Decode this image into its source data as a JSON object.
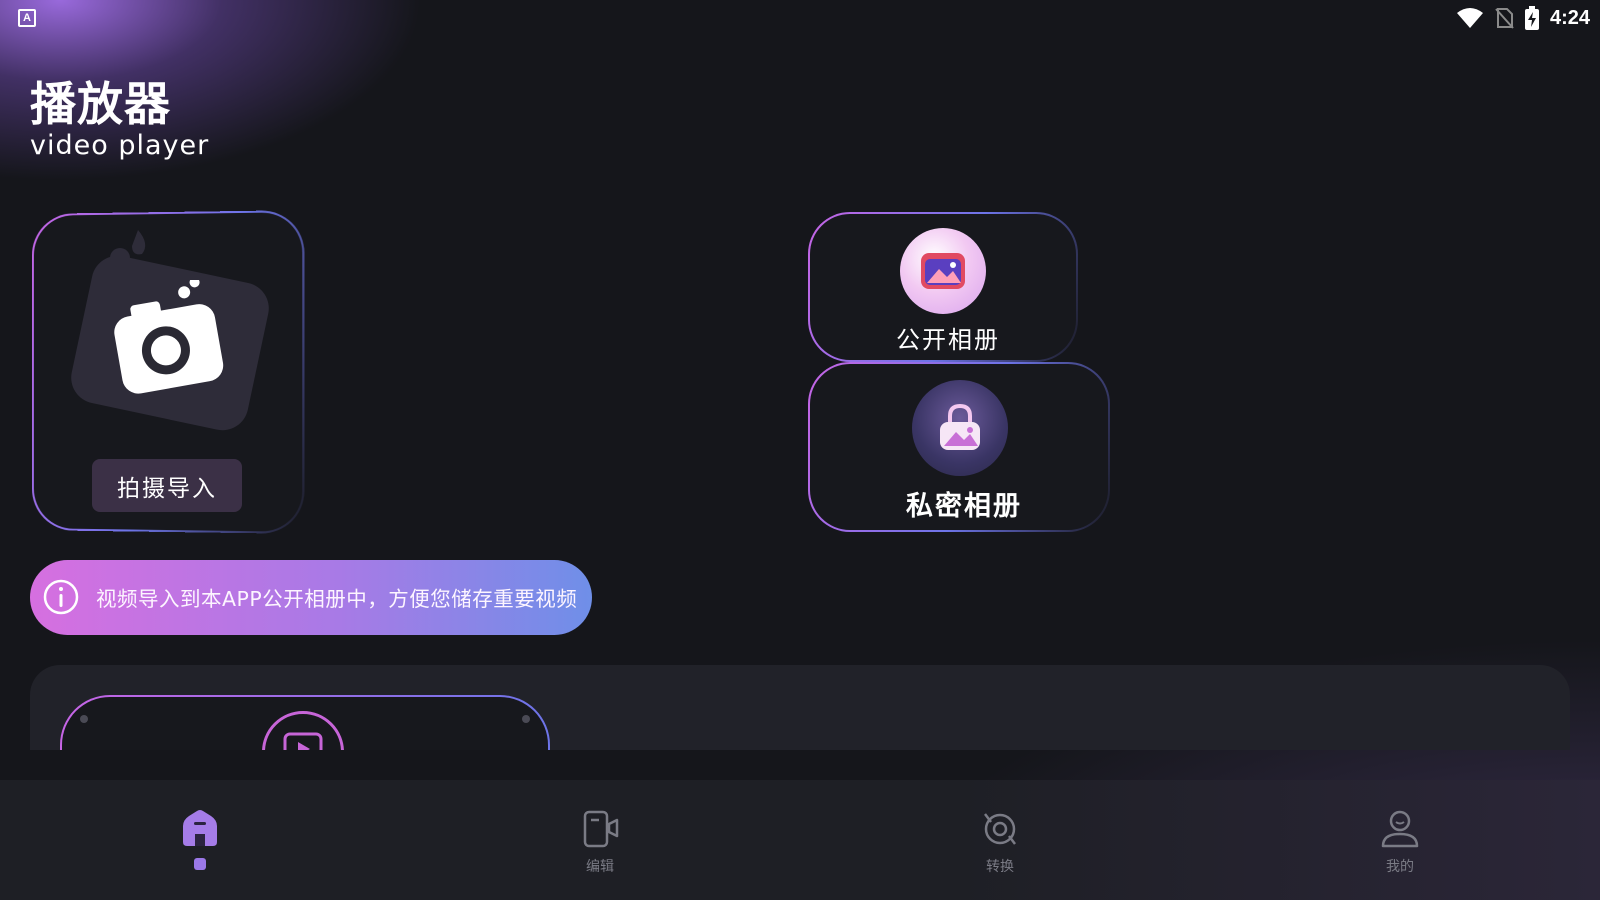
{
  "status_bar": {
    "app_icon_letter": "A",
    "time": "4:24"
  },
  "header": {
    "title": "播放器",
    "subtitle": "video  player"
  },
  "shoot_card": {
    "button_label": "拍摄导入"
  },
  "albums": {
    "public_label": "公开相册",
    "private_label": "私密相册"
  },
  "info_banner": {
    "text": "视频导入到本APP公开相册中，方便您储存重要视频"
  },
  "bottom_nav": {
    "items": [
      {
        "label": "",
        "icon": "home-icon",
        "active": true
      },
      {
        "label": "编辑",
        "icon": "edit-video-icon",
        "active": false
      },
      {
        "label": "转换",
        "icon": "convert-icon",
        "active": false
      },
      {
        "label": "我的",
        "icon": "profile-icon",
        "active": false
      }
    ]
  },
  "colors": {
    "background": "#15161b",
    "accent_purple": "#c765e6",
    "accent_blue": "#6d74e8",
    "nav_active": "#9b78e8",
    "nav_inactive": "#7a7b85"
  }
}
